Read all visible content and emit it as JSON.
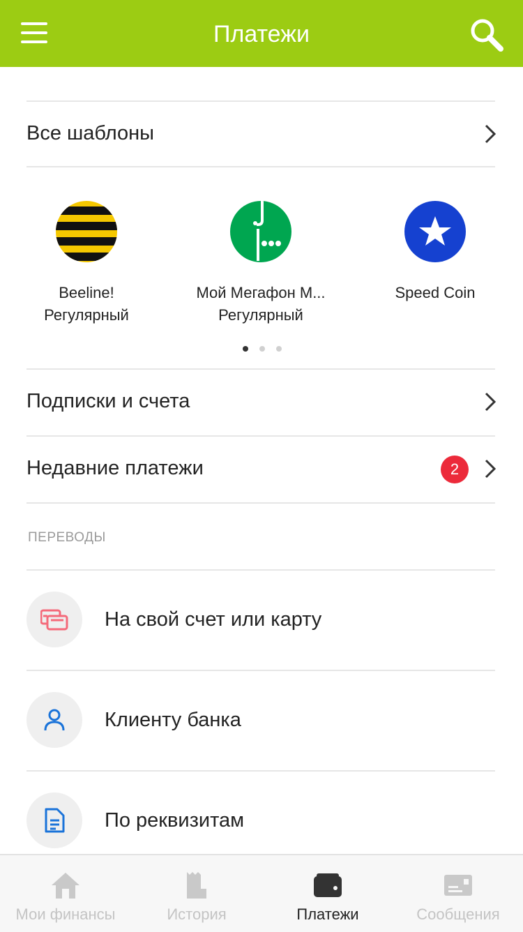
{
  "header": {
    "title": "Платежи",
    "menu_icon": "menu-icon",
    "search_icon": "search-icon",
    "color": "#9ccc13"
  },
  "rows": {
    "all_templates": "Все шаблоны",
    "subscriptions": "Подписки и счета",
    "recent": "Недавние платежи",
    "recent_badge": "2"
  },
  "templates": [
    {
      "line1": "Beeline!",
      "line2": "Регулярный",
      "icon": "beeline-logo"
    },
    {
      "line1": "Мой Мегафон М...",
      "line2": "Регулярный",
      "icon": "megafon-logo"
    },
    {
      "line1": "Speed Coin",
      "line2": "",
      "icon": "star-icon"
    }
  ],
  "carousel": {
    "pages": 3,
    "active": 1
  },
  "transfers": {
    "section_title": "ПЕРЕВОДЫ",
    "items": [
      {
        "label": "На свой счет или карту",
        "icon": "cards-icon"
      },
      {
        "label": "Клиенту банка",
        "icon": "person-icon"
      },
      {
        "label": "По реквизитам",
        "icon": "document-icon"
      }
    ]
  },
  "tabbar": {
    "tabs": [
      {
        "label": "Мои финансы",
        "icon": "home-icon",
        "active": false
      },
      {
        "label": "История",
        "icon": "receipt-icon",
        "active": false
      },
      {
        "label": "Платежи",
        "icon": "wallet-icon",
        "active": true
      },
      {
        "label": "Сообщения",
        "icon": "message-icon",
        "active": false
      }
    ]
  },
  "colors": {
    "accent": "#9ccc13",
    "badge": "#ec2a3a",
    "megafon": "#00a650",
    "speedcoin": "#1541d0",
    "beeline": "#f5c800"
  }
}
